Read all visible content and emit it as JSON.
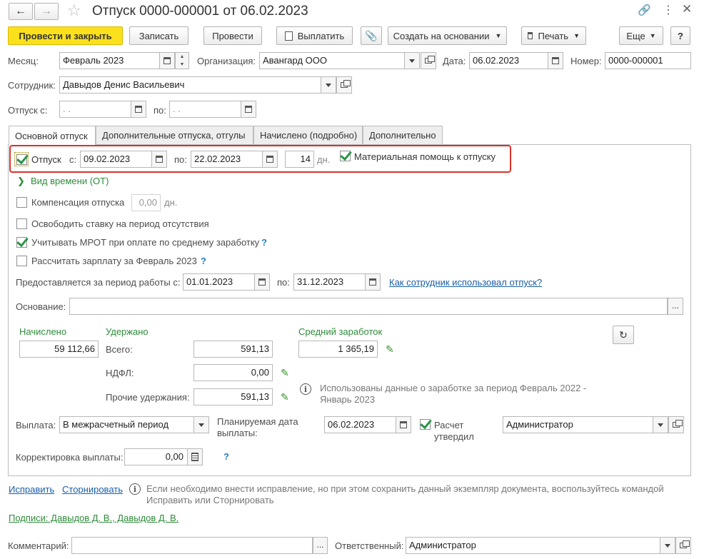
{
  "window": {
    "title": "Отпуск 0000-000001 от 06.02.2023"
  },
  "toolbar": {
    "post_close": "Провести и закрыть",
    "save": "Записать",
    "post": "Провести",
    "pay": "Выплатить",
    "create_based": "Создать на основании",
    "print": "Печать",
    "more": "Еще",
    "help": "?"
  },
  "header": {
    "month_label": "Месяц:",
    "month_value": "Февраль 2023",
    "org_label": "Организация:",
    "org_value": "Авангард ООО",
    "date_label": "Дата:",
    "date_value": "06.02.2023",
    "number_label": "Номер:",
    "number_value": "0000-000001",
    "employee_label": "Сотрудник:",
    "employee_value": "Давыдов Денис Васильевич",
    "leave_from_label": "Отпуск с:",
    "leave_from_value": " .  .",
    "leave_to_label": "по:",
    "leave_to_value": " .  ."
  },
  "tabs": [
    {
      "label": "Основной отпуск"
    },
    {
      "label": "Дополнительные отпуска, отгулы"
    },
    {
      "label": "Начислено (подробно)"
    },
    {
      "label": "Дополнительно"
    }
  ],
  "main_leave": {
    "checkbox_label": "Отпуск",
    "from_label": "с:",
    "from_value": "09.02.2023",
    "to_label": "по:",
    "to_value": "22.02.2023",
    "days_value": "14",
    "days_unit": "дн.",
    "aid_label": "Материальная помощь к отпуску",
    "time_type_label": "Вид времени (ОТ)",
    "compensation_label": "Компенсация отпуска",
    "compensation_value": "0,00",
    "compensation_unit": "дн.",
    "free_rate_label": "Освободить ставку на период отсутствия",
    "mrot_label": "Учитывать МРОТ при оплате по среднему заработку",
    "calc_salary_label": "Рассчитать зарплату за Февраль 2023",
    "period_label": "Предоставляется за период работы с:",
    "period_from": "01.01.2023",
    "period_to_label": "по:",
    "period_to": "31.12.2023",
    "usage_link": "Как сотрудник использовал отпуск?",
    "basis_label": "Основание:",
    "basis_value": "",
    "basis_btn": "..."
  },
  "amounts": {
    "accrued_title": "Начислено",
    "accrued_value": "59 112,66",
    "withheld_title": "Удержано",
    "total_label": "Всего:",
    "total_value": "591,13",
    "ndfl_label": "НДФЛ:",
    "ndfl_value": "0,00",
    "other_label": "Прочие удержания:",
    "other_value": "591,13",
    "avg_title": "Средний заработок",
    "avg_value": "1 365,19",
    "avg_note": "Использованы данные о заработке за период Февраль 2022 - Январь 2023"
  },
  "payment": {
    "label": "Выплата:",
    "value": "В межрасчетный период",
    "planned_label": "Планируемая дата выплаты:",
    "planned_value": "06.02.2023",
    "approved_label": "Расчет утвердил",
    "approved_value": "Администратор",
    "correction_label": "Корректировка выплаты:",
    "correction_value": "0,00"
  },
  "footer": {
    "fix_link": "Исправить",
    "reverse_link": "Сторнировать",
    "fix_note": "Если необходимо внести исправление, но при этом сохранить данный экземпляр документа, воспользуйтесь командой Исправить или Сторнировать",
    "signatures_link": "Подписи: Давыдов Д. В., Давыдов Д. В.",
    "comment_label": "Комментарий:",
    "comment_value": "",
    "comment_btn": "...",
    "responsible_label": "Ответственный:",
    "responsible_value": "Администратор"
  },
  "colors": {
    "primary_button": "#fbe01c",
    "highlight_frame": "#d9322a",
    "checkbox_green": "#2c9448",
    "link_blue": "#1a5fa8",
    "section_green": "#2e8b3a"
  }
}
